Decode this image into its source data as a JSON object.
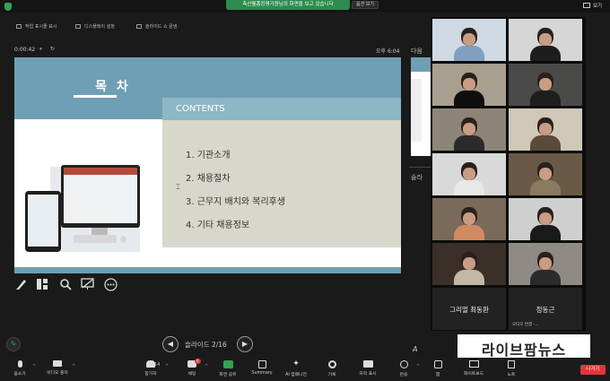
{
  "topbar": {
    "share_banner": "측산웰폼킹평가원님의 화면을 보고 있습니다",
    "options_label": "옵션 보기",
    "view_label": "보기"
  },
  "toolbar_top": {
    "items": [
      "작업 표시줄 표시",
      "디스플레이 설정",
      "슬라이드 쇼 끝냄"
    ]
  },
  "presenter": {
    "elapsed": "0:00:42",
    "clock": "오후 6:04",
    "next_label": "다음",
    "notes_label": "슬라",
    "slide_counter": "슬라이드 2/16"
  },
  "slide": {
    "title": "목 차",
    "contents_heading": "CONTENTS",
    "agenda": [
      "1. 기관소개",
      "2. 채용절차",
      "3. 근무지 배치와 복리후생",
      "4. 기타 채용정보"
    ]
  },
  "gallery": {
    "active_tile": 0,
    "tiles": [
      {
        "kind": "video",
        "bg": "#cfd9e3",
        "shirt": "#7fa0c0"
      },
      {
        "kind": "video",
        "bg": "#d6d6d6",
        "shirt": "#1d1d1d"
      },
      {
        "kind": "video",
        "bg": "#a89f90",
        "shirt": "#0e0e0e"
      },
      {
        "kind": "video",
        "bg": "#4a4a48",
        "shirt": "#1e1e1e"
      },
      {
        "kind": "video",
        "bg": "#8d8578",
        "shirt": "#2b2b2b"
      },
      {
        "kind": "video",
        "bg": "#cfc8b8",
        "shirt": "#5a4a38"
      },
      {
        "kind": "video",
        "bg": "#d9d9d9",
        "shirt": "#e8e8e8"
      },
      {
        "kind": "video",
        "bg": "#6a5a45",
        "shirt": "#8a7a60"
      },
      {
        "kind": "video",
        "bg": "#7a6a5a",
        "shirt": "#d28a62"
      },
      {
        "kind": "video",
        "bg": "#cfcfcf",
        "shirt": "#1a1a1a"
      },
      {
        "kind": "video",
        "bg": "#3a3028",
        "shirt": "#c0b9a8"
      },
      {
        "kind": "video",
        "bg": "#8f8a84",
        "shirt": "#2b2b2b"
      },
      {
        "kind": "video",
        "bg": "#7a6a55",
        "shirt": "#222"
      },
      {
        "kind": "video",
        "bg": "#4a4038",
        "shirt": "#1a1a1a"
      }
    ],
    "name_tiles": [
      {
        "name": "그리멀 최동환"
      },
      {
        "name": "정동근",
        "audio_label": "오디오 연결 -..."
      }
    ]
  },
  "bottom_toolbar": {
    "mute": "음소거",
    "video": "비디오 중지",
    "participants": "참가자",
    "participants_count": "14",
    "chat": "채팅",
    "chat_badge": "6",
    "share": "화면 공유",
    "summary": "Summary",
    "ai": "AI 컴패니언",
    "record": "기록",
    "captions": "자막 표시",
    "reactions": "반응",
    "apps": "앱",
    "whiteboards": "화이트보드",
    "notes": "노트",
    "leave": "나가기"
  },
  "watermark": {
    "text": "라이브팜뉴스"
  },
  "colors": {
    "accent_green": "#2ea44f",
    "leave_red": "#e5343a",
    "slide_blue": "#6f9fb4"
  }
}
